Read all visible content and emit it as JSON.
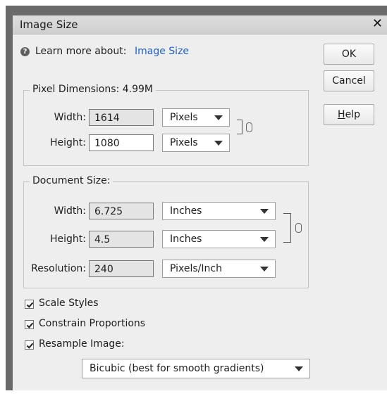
{
  "window": {
    "title": "Image Size",
    "close_glyph": "✕"
  },
  "learn_more": {
    "icon": "help-circle-icon",
    "prefix": "Learn more about:",
    "link": "Image Size"
  },
  "buttons": {
    "ok": "OK",
    "cancel": "Cancel",
    "help": "Help"
  },
  "pixel_dimensions": {
    "legend": "Pixel Dimensions:",
    "size": "4.99M",
    "width_label": "Width:",
    "width_value": "1614",
    "width_unit": "Pixels",
    "height_label": "Height:",
    "height_value": "1080",
    "height_unit": "Pixels"
  },
  "document_size": {
    "legend": "Document Size:",
    "width_label": "Width:",
    "width_value": "6.725",
    "width_unit": "Inches",
    "height_label": "Height:",
    "height_value": "4.5",
    "height_unit": "Inches",
    "resolution_label": "Resolution:",
    "resolution_value": "240",
    "resolution_unit": "Pixels/Inch"
  },
  "options": {
    "scale_styles": "Scale Styles",
    "constrain_proportions": "Constrain Proportions",
    "resample_image": "Resample Image:",
    "resample_method": "Bicubic (best for smooth gradients)"
  },
  "colors": {
    "link": "#1f5fc8",
    "dialog_bg": "#eeeeee",
    "frame": "#6a6a6a"
  }
}
